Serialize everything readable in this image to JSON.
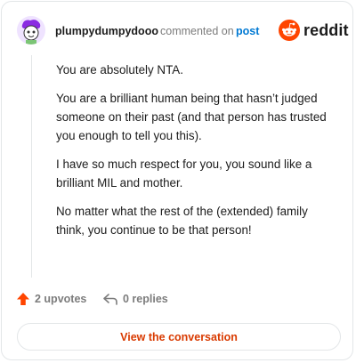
{
  "header": {
    "username": "plumpydumpydooo",
    "commented_text": "commented on",
    "post_link": "post",
    "brand": "reddit",
    "brand_color": "#ff4500"
  },
  "comment": {
    "paragraphs": [
      "You are absolutely NTA.",
      "You are a brilliant human being that hasn’t judged someone on their past (and that person has trusted you enough to tell you this).",
      "I have so much respect for you, you sound like a brilliant MIL and mother.",
      "No matter what the rest of the (extended) family think, you continue to be that person!"
    ]
  },
  "actions": {
    "upvotes_label": "2 upvotes",
    "replies_label": "0 replies",
    "upvote_icon": "upvote-arrow-icon",
    "reply_icon": "reply-arrow-icon",
    "upvote_color": "#ff4500"
  },
  "footer": {
    "view_conversation_label": "View the conversation",
    "accent": "#d93a00"
  }
}
